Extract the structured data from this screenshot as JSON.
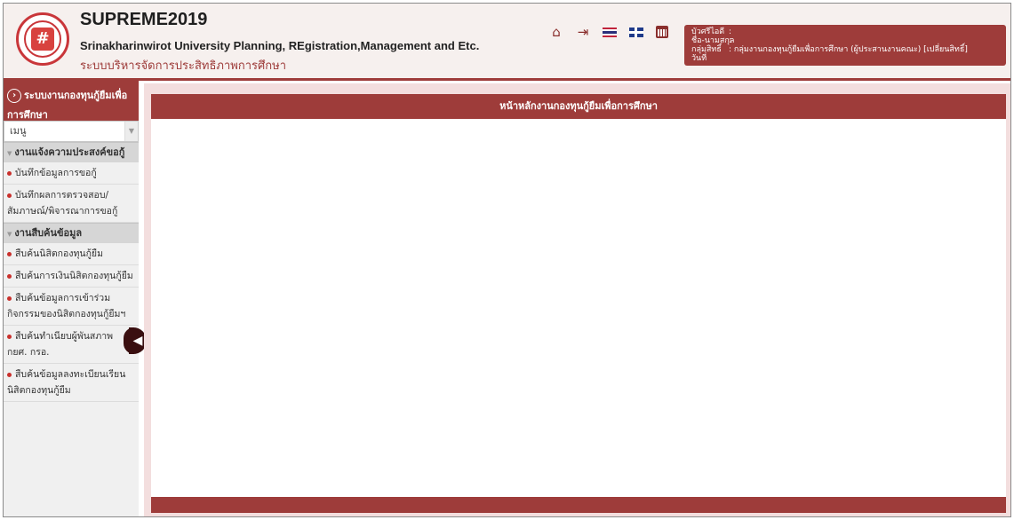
{
  "header": {
    "title": "SUPREME2019",
    "subtitle": "Srinakharinwirot University Planning, REgistration,Management and Etc.",
    "thai_title": "ระบบบริหารจัดการประสิทธิภาพการศึกษา"
  },
  "toolbar": {
    "icons": [
      "home-icon",
      "logout-icon",
      "thai-flag-icon",
      "uk-flag-icon",
      "calendar-icon"
    ],
    "home": "⌂",
    "logout": "⇥"
  },
  "user": {
    "id_label": "บัวศรีไอดี",
    "id_value": ":",
    "name_label": "ชื่อ-นามสกุล",
    "name_value": ":",
    "role_label": "กลุ่มสิทธิ์",
    "role_value": ": กลุ่มงานกองทุนกู้ยืมเพื่อการศึกษา (ผู้ประสานงานคณะ) [เปลี่ยนสิทธิ์]",
    "date_label": "วันที่",
    "date_value": ""
  },
  "sidebar": {
    "heading": "ระบบงานกองทุนกู้ยืมเพื่อการศึกษา",
    "select_value": "เมนู",
    "groups": [
      {
        "label": "งานแจ้งความประสงค์ขอกู้",
        "items": [
          "บันทึกข้อมูลการขอกู้",
          "บันทึกผลการตรวจสอบ/สัมภาษณ์/พิจารณาการขอกู้"
        ]
      },
      {
        "label": "งานสืบค้นข้อมูล",
        "items": [
          "สืบค้นนิสิตกองทุนกู้ยืม",
          "สืบค้นการเงินนิสิตกองทุนกู้ยืม",
          "สืบค้นข้อมูลการเข้าร่วมกิจกรรมของนิสิตกองทุนกู้ยืมฯ",
          "สืบค้นทำเนียบผู้พันสภาพ กยศ. กรอ.",
          "สืบค้นข้อมูลลงทะเบียนเรียนนิสิตกองทุนกู้ยืม"
        ]
      }
    ]
  },
  "main": {
    "panel_title": "หน้าหลักงานกองทุนกู้ยืมเพื่อการศึกษา"
  }
}
